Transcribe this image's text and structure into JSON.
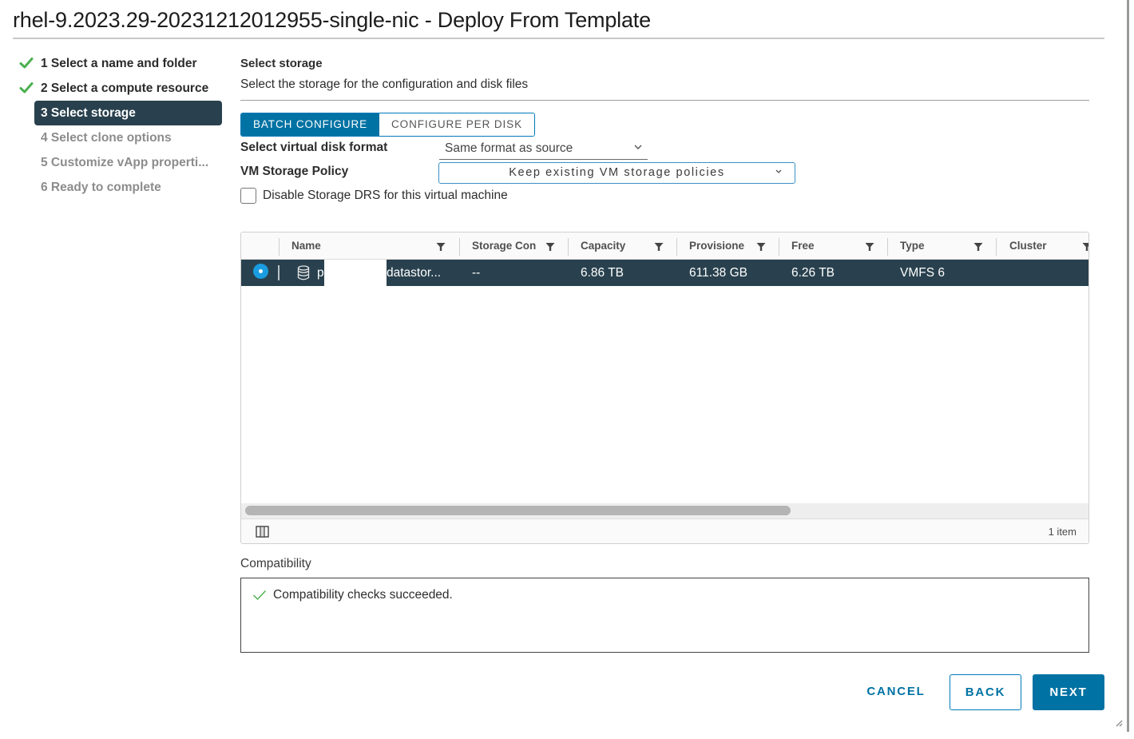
{
  "window": {
    "title": "rhel-9.2023.29-20231212012955-single-nic - Deploy From Template"
  },
  "steps": [
    {
      "number": "1",
      "label": "1 Select a name and folder",
      "state": "done"
    },
    {
      "number": "2",
      "label": "2 Select a compute resource",
      "state": "done"
    },
    {
      "number": "3",
      "label": "3 Select storage",
      "state": "active"
    },
    {
      "number": "4",
      "label": "4 Select clone options",
      "state": "pending"
    },
    {
      "number": "5",
      "label": "5 Customize vApp properti...",
      "state": "pending"
    },
    {
      "number": "6",
      "label": "6 Ready to complete",
      "state": "pending"
    }
  ],
  "main": {
    "title": "Select storage",
    "description": "Select the storage for the configuration and disk files",
    "mode_tabs": [
      {
        "label": "BATCH CONFIGURE",
        "selected": true
      },
      {
        "label": "CONFIGURE PER DISK",
        "selected": false
      }
    ],
    "disk_format": {
      "label": "Select virtual disk format",
      "value": "Same format as source"
    },
    "storage_policy": {
      "label": "VM Storage Policy",
      "value": "Keep existing VM storage policies"
    },
    "disable_drs": {
      "label": "Disable Storage DRS for this virtual machine",
      "checked": false
    }
  },
  "grid": {
    "columns": [
      "Name",
      "Storage Con",
      "Capacity",
      "Provisione",
      "Free",
      "Type",
      "Cluster"
    ],
    "rows": [
      {
        "selected": true,
        "name_prefix": "p",
        "name_suffix": "datastor...",
        "storage_compatibility": "--",
        "capacity": "6.86 TB",
        "provisioned": "611.38 GB",
        "free": "6.26 TB",
        "type": "VMFS 6",
        "cluster": ""
      }
    ],
    "footer_count": "1 item"
  },
  "compatibility": {
    "label": "Compatibility",
    "message": "Compatibility checks succeeded.",
    "status": "success"
  },
  "buttons": {
    "cancel": "CANCEL",
    "back": "BACK",
    "next": "NEXT"
  },
  "colors": {
    "primary": "#0072a3",
    "selected_row": "#29414e",
    "success": "#4caf50"
  }
}
